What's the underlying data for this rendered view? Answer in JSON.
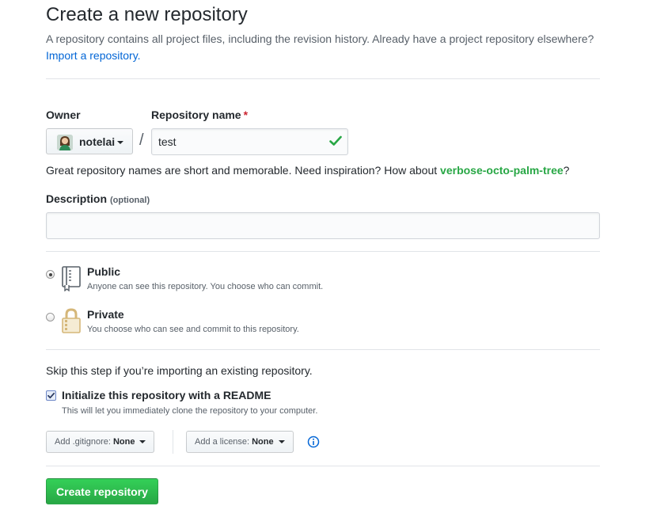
{
  "header": {
    "title": "Create a new repository",
    "lead": "A repository contains all project files, including the revision history. Already have a project repository elsewhere?",
    "import_link": "Import a repository."
  },
  "owner": {
    "label": "Owner",
    "value": "notelai",
    "avatar_icon": "user-avatar"
  },
  "repo_name": {
    "label": "Repository name",
    "required_mark": "*",
    "separator": "/",
    "value": "test",
    "valid_icon": "check-icon"
  },
  "hint": {
    "text": "Great repository names are short and memorable. Need inspiration? How about ",
    "suggestion": "verbose-octo-palm-tree",
    "end": "?"
  },
  "description": {
    "label": "Description",
    "optional": "(optional)",
    "value": ""
  },
  "visibility": {
    "selected": "Public",
    "public": {
      "title": "Public",
      "subtitle": "Anyone can see this repository. You choose who can commit.",
      "icon": "repo-book-icon"
    },
    "private": {
      "title": "Private",
      "subtitle": "You choose who can see and commit to this repository.",
      "icon": "lock-icon"
    }
  },
  "init": {
    "skip_text": "Skip this step if you’re importing an existing repository.",
    "readme_label": "Initialize this repository with a README",
    "readme_note": "This will let you immediately clone the repository to your computer.",
    "readme_checked": true
  },
  "addons": {
    "gitignore_label": "Add .gitignore:",
    "gitignore_value": "None",
    "license_label": "Add a license:",
    "license_value": "None",
    "info_icon": "info-icon"
  },
  "submit": {
    "label": "Create repository"
  },
  "colors": {
    "link": "#0366d6",
    "suggestion": "#28a745",
    "required": "#cb2431",
    "primary_button": "#28a745"
  }
}
